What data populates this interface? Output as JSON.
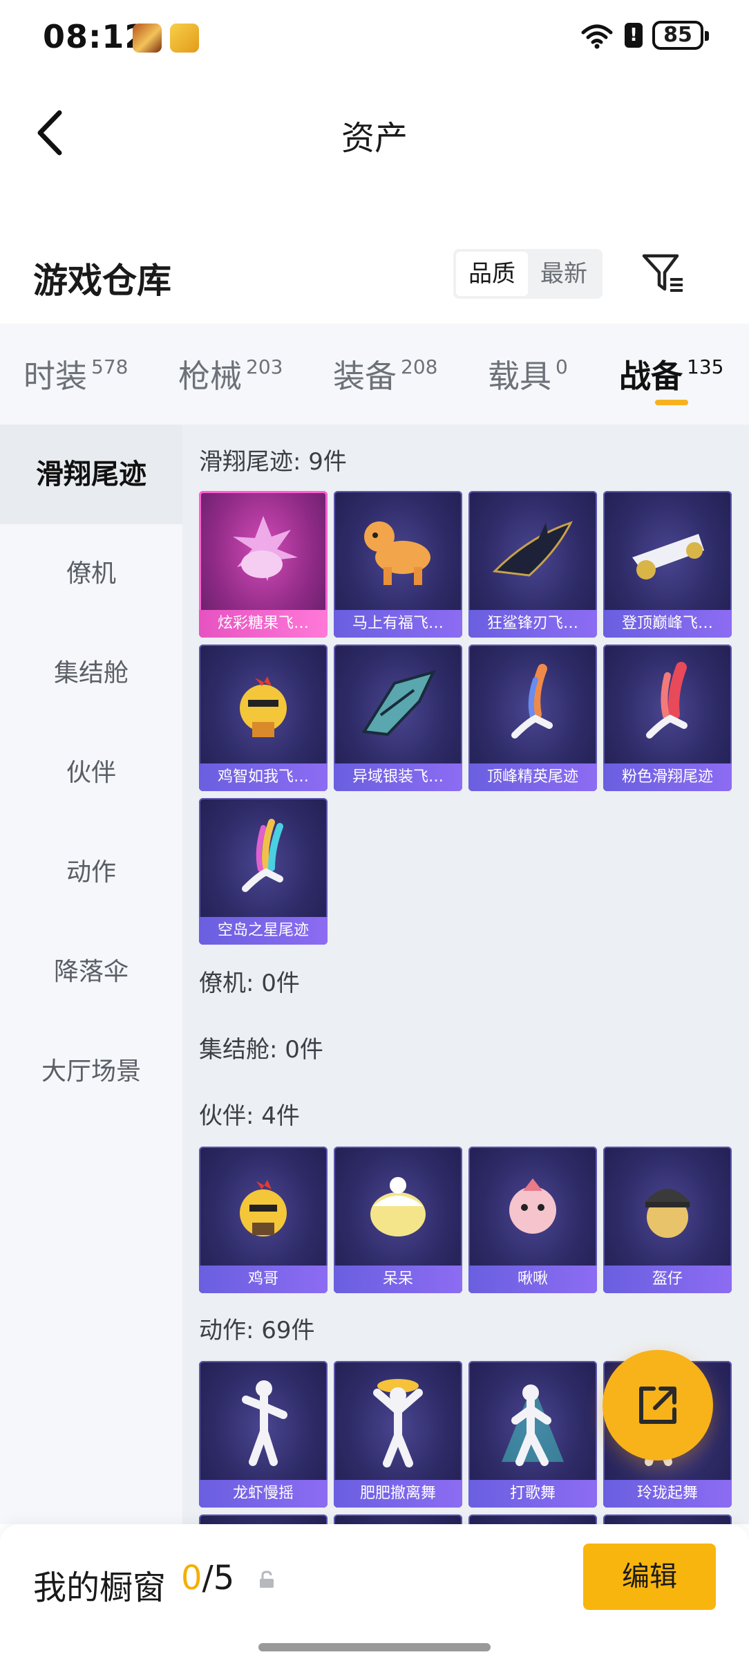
{
  "status_bar": {
    "time": "08:12",
    "battery": "85",
    "alert": "!"
  },
  "header": {
    "title": "资产"
  },
  "section": {
    "title": "游戏仓库"
  },
  "sort": {
    "options": [
      "品质",
      "最新"
    ],
    "active_index": 0
  },
  "tabs": [
    {
      "label": "时装",
      "count": "578"
    },
    {
      "label": "枪械",
      "count": "203"
    },
    {
      "label": "装备",
      "count": "208"
    },
    {
      "label": "载具",
      "count": "0"
    },
    {
      "label": "战备",
      "count": "135",
      "active": true
    }
  ],
  "sidebar": {
    "items": [
      "滑翔尾迹",
      "僚机",
      "集结舱",
      "伙伴",
      "动作",
      "降落伞",
      "大厅场景"
    ],
    "active_index": 0
  },
  "groups": {
    "glide": {
      "title": "滑翔尾迹: 9件",
      "items": [
        "炫彩糖果飞…",
        "马上有福飞…",
        "狂鲨锋刃飞…",
        "登顶巅峰飞…",
        "鸡智如我飞…",
        "异域银装飞…",
        "顶峰精英尾迹",
        "粉色滑翔尾迹",
        "空岛之星尾迹"
      ]
    },
    "wingman": {
      "title": "僚机: 0件"
    },
    "pod": {
      "title": "集结舱: 0件"
    },
    "companion": {
      "title": "伙伴: 4件",
      "items": [
        "鸡哥",
        "呆呆",
        "啾啾",
        "盔仔"
      ]
    },
    "emote": {
      "title": "动作: 69件",
      "items": [
        "龙虾慢摇",
        "肥肥撤离舞",
        "打歌舞",
        "玲珑起舞"
      ]
    }
  },
  "bottom": {
    "showcase_label": "我的橱窗",
    "showcase_current": "0",
    "showcase_sep": "/",
    "showcase_max": "5",
    "edit_label": "编辑"
  },
  "colors": {
    "accent": "#f8b50e",
    "card_bg": "#2d2a66",
    "card_label": "#7a66ea",
    "selected": "#e653c1"
  }
}
